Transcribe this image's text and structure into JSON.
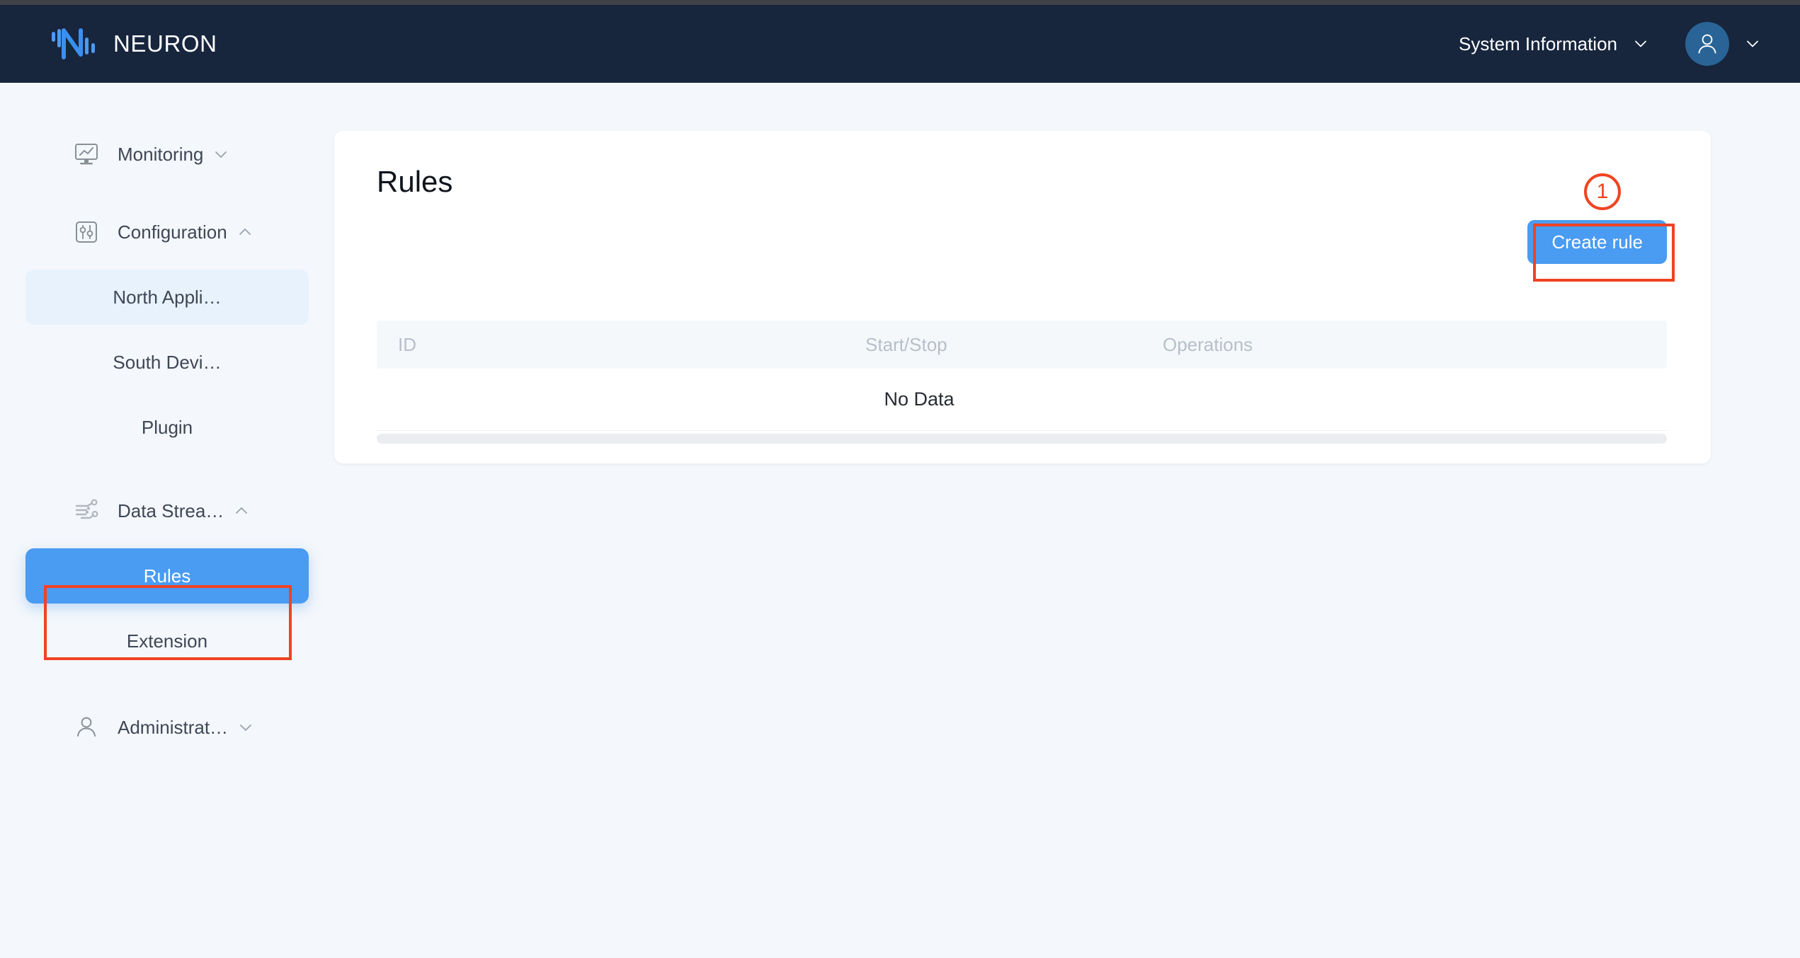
{
  "header": {
    "brand_name": "NEURON",
    "logo_icon": "neuron-logo-icon",
    "system_information_label": "System Information",
    "system_information_caret": "chevron-down-icon",
    "avatar_icon": "user-avatar-icon",
    "avatar_caret": "chevron-down-icon"
  },
  "sidebar": {
    "groups": [
      {
        "label": "Monitoring",
        "icon": "monitor-chart-icon",
        "arrow": "chevron-down-icon",
        "expanded": false,
        "children": []
      },
      {
        "label": "Configuration",
        "icon": "sliders-icon",
        "arrow": "chevron-up-icon",
        "expanded": true,
        "children": [
          {
            "label": "North Appli…",
            "state": "soft-selected"
          },
          {
            "label": "South Devi…",
            "state": "normal"
          },
          {
            "label": "Plugin",
            "state": "normal"
          }
        ]
      },
      {
        "label": "Data Strea…",
        "icon": "data-stream-icon",
        "arrow": "chevron-up-icon",
        "expanded": true,
        "children": [
          {
            "label": "Rules",
            "state": "selected"
          },
          {
            "label": "Extension",
            "state": "normal"
          }
        ]
      },
      {
        "label": "Administrat…",
        "icon": "user-icon",
        "arrow": "chevron-down-icon",
        "expanded": false,
        "children": []
      }
    ]
  },
  "main": {
    "page_title": "Rules",
    "create_rule_label": "Create rule",
    "table": {
      "columns": [
        "ID",
        "Start/Stop",
        "Operations"
      ],
      "rows": [],
      "empty_text": "No Data"
    }
  },
  "annotations": [
    {
      "badge": "1",
      "target": "create-rule-button"
    },
    {
      "badge": "",
      "target": "sidebar-item-rules"
    }
  ],
  "colors": {
    "header_bg": "#17253d",
    "page_bg": "#f4f7fb",
    "accent_blue": "#4a9bf2",
    "soft_blue": "#e8f2fd",
    "annotation_red": "#f04322",
    "avatar_bg": "#2a6496",
    "table_header_text": "#b7bfca"
  }
}
